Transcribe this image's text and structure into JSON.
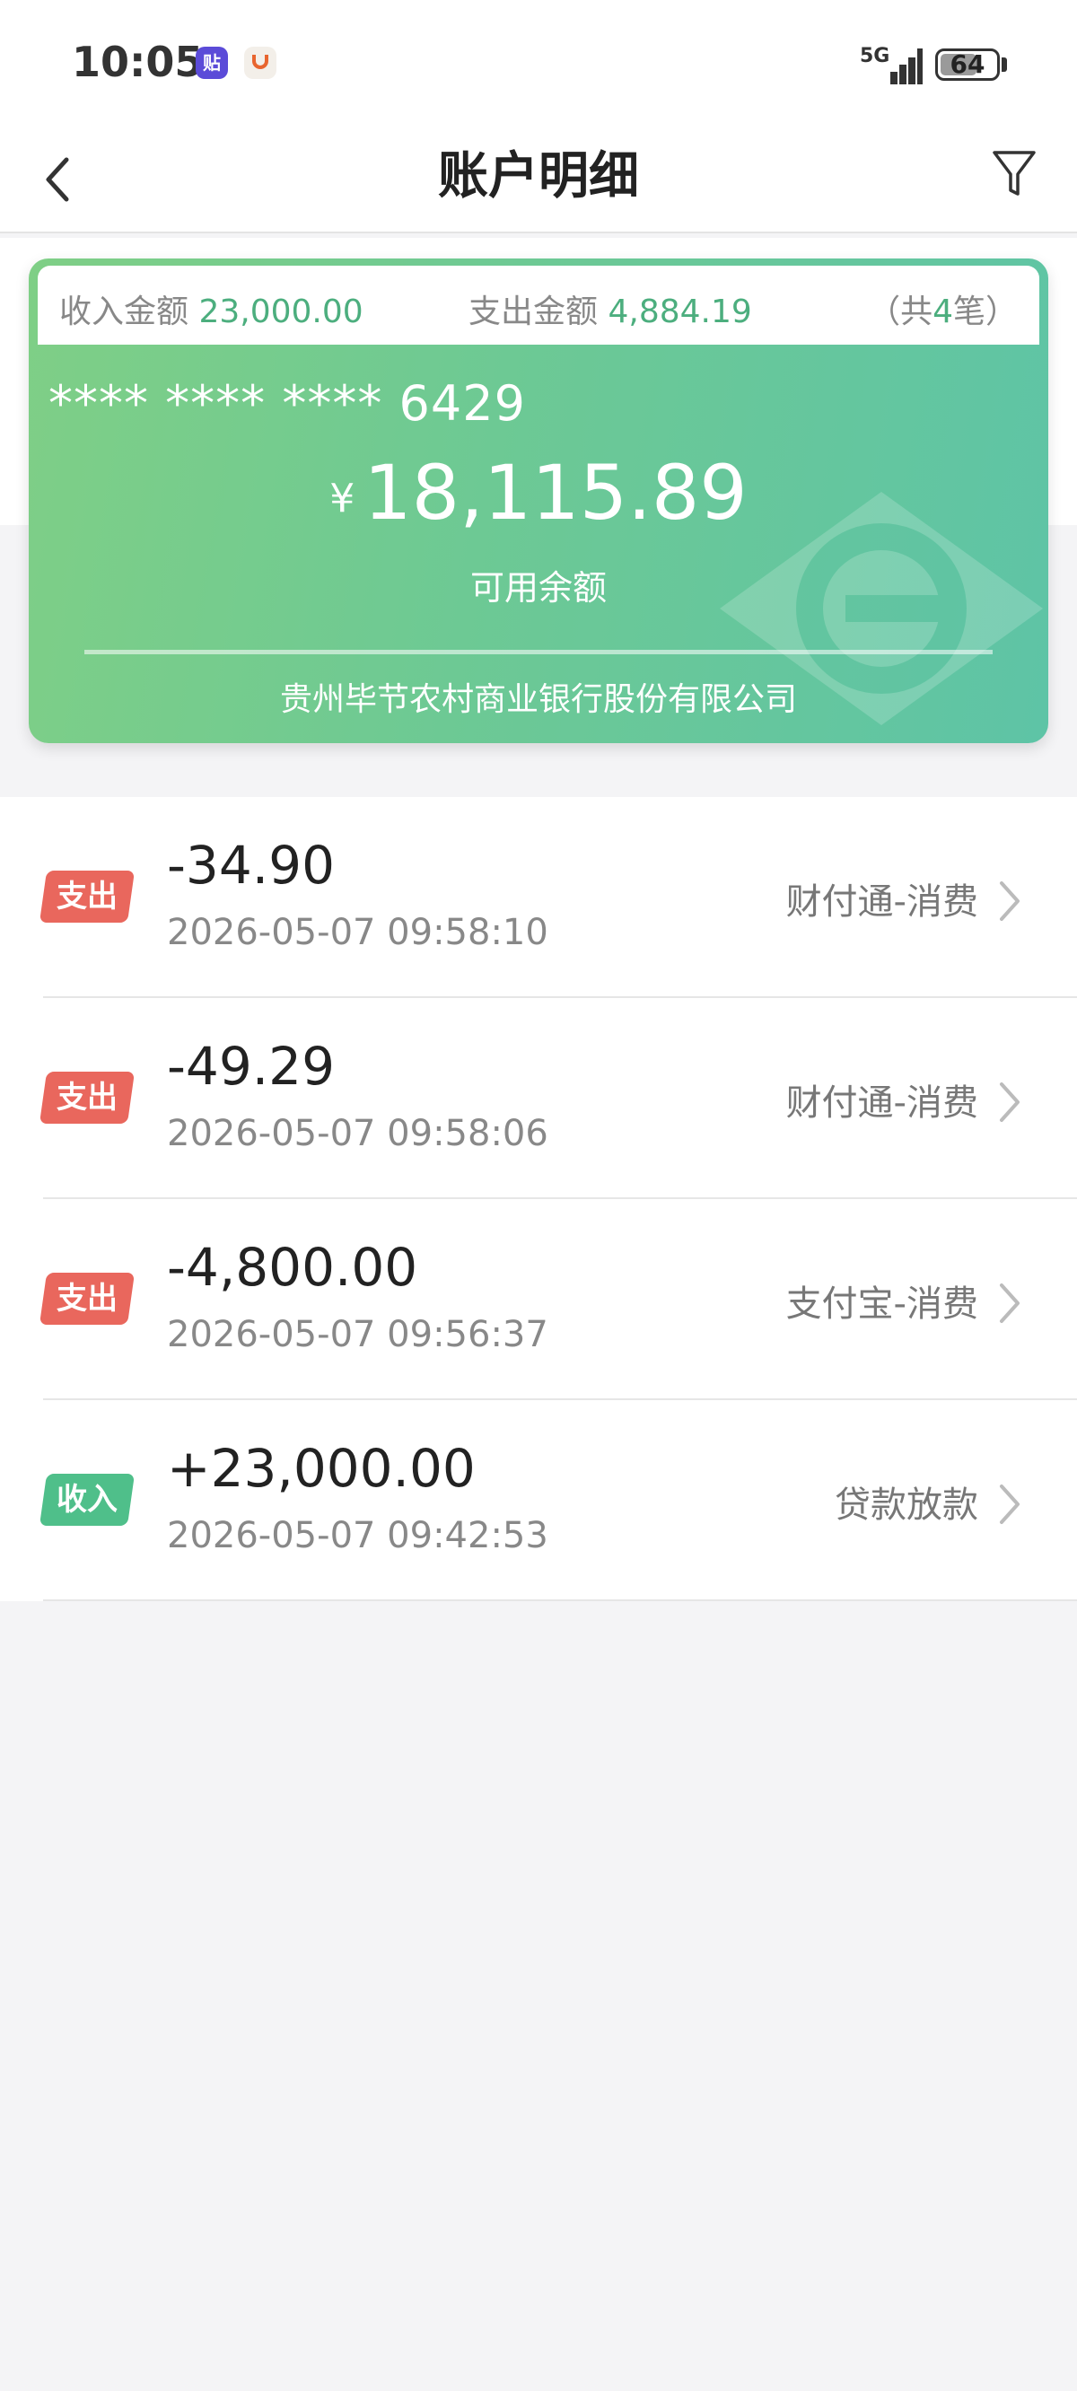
{
  "status_bar": {
    "time": "10:05",
    "notif_1": "贴",
    "network": "5G",
    "battery": "64"
  },
  "nav": {
    "title": "账户明细"
  },
  "summary": {
    "income_label": "收入金额",
    "income_value": "23,000.00",
    "expense_label": "支出金额",
    "expense_value": "4,884.19",
    "count_prefix": "（共",
    "count_value": "4",
    "count_suffix": "笔）"
  },
  "card": {
    "number": "**** **** **** 6429",
    "currency": "¥",
    "balance": "18,115.89",
    "balance_label": "可用余额",
    "bank_name": "贵州毕节农村商业银行股份有限公司"
  },
  "transactions": [
    {
      "type": "支出",
      "amount": "-34.90",
      "time": "2026-05-07 09:58:10",
      "desc": "财付通-消费"
    },
    {
      "type": "支出",
      "amount": "-49.29",
      "time": "2026-05-07 09:58:06",
      "desc": "财付通-消费"
    },
    {
      "type": "支出",
      "amount": "-4,800.00",
      "time": "2026-05-07 09:56:37",
      "desc": "支付宝-消费"
    },
    {
      "type": "收入",
      "amount": "+23,000.00",
      "time": "2026-05-07 09:42:53",
      "desc": "贷款放款"
    }
  ],
  "colors": {
    "card_green": "#6dc994",
    "accent_green": "#4cae7e",
    "expense_red": "#e9675d",
    "income_green": "#4fbf8a"
  },
  "icons": [
    "back-icon",
    "filter-icon",
    "chevron-right-icon",
    "battery-icon",
    "signal-icon"
  ]
}
